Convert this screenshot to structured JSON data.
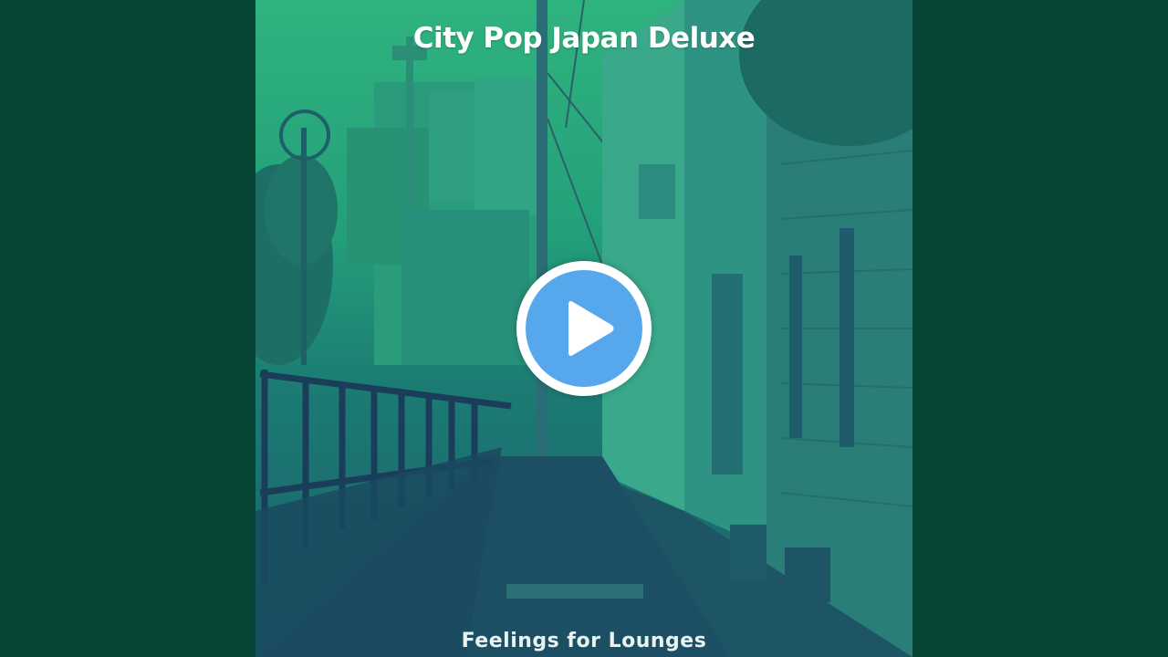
{
  "video": {
    "album_title": "City Pop Japan Deluxe",
    "track_title": "Feelings for Lounges"
  },
  "controls": {
    "play_icon": "play-icon"
  },
  "colors": {
    "background": "#074634",
    "play_button_fill": "#56a7ec",
    "play_button_ring": "#ffffff"
  }
}
